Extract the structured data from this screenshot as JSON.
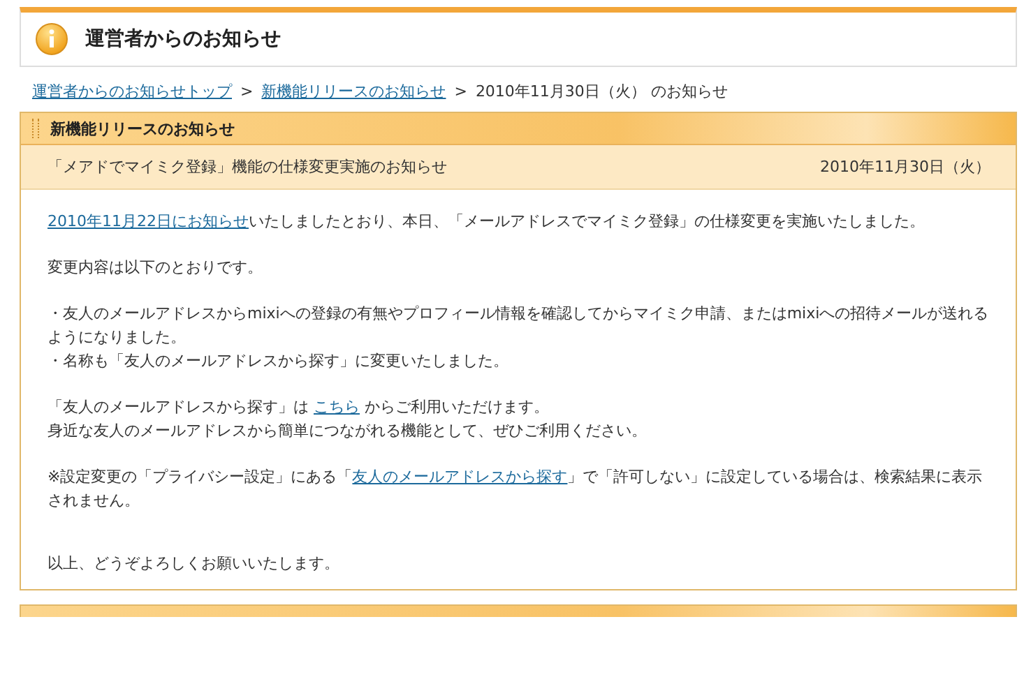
{
  "page_title": "運営者からのお知らせ",
  "breadcrumb": [
    {
      "text": "運営者からのお知らせトップ",
      "kind": "link"
    },
    {
      "text": ">",
      "kind": "separator"
    },
    {
      "text": "新機能リリースのお知らせ",
      "kind": "link"
    },
    {
      "text": ">",
      "kind": "separator"
    },
    {
      "text": "2010年11月30日（火） のお知らせ",
      "kind": "current"
    }
  ],
  "panel": {
    "title": "新機能リリースのお知らせ",
    "subject": "「メアドでマイミク登録」機能の仕様変更実施のお知らせ",
    "date": "2010年11月30日（火）",
    "blocks": [
      {
        "lines": [
          [
            {
              "kind": "link",
              "text": "2010年11月22日にお知らせ"
            },
            {
              "kind": "text",
              "text": "いたしましたとおり、本日、「メールアドレスでマイミク登録」の仕様変更を実施いたしました。"
            }
          ]
        ]
      },
      {
        "lines": [
          [
            {
              "kind": "text",
              "text": "変更内容は以下のとおりです。"
            }
          ]
        ]
      },
      {
        "lines": [
          [
            {
              "kind": "text",
              "text": "・友人のメールアドレスからmixiへの登録の有無やプロフィール情報を確認してからマイミク申請、またはmixiへの招待メールが送れるようになりました。"
            }
          ],
          [
            {
              "kind": "text",
              "text": "・名称も「友人のメールアドレスから探す」に変更いたしました。"
            }
          ]
        ]
      },
      {
        "lines": [
          [
            {
              "kind": "text",
              "text": "「友人のメールアドレスから探す」は "
            },
            {
              "kind": "link",
              "text": "こちら"
            },
            {
              "kind": "text",
              "text": " からご利用いただけます。"
            }
          ],
          [
            {
              "kind": "text",
              "text": "身近な友人のメールアドレスから簡単につながれる機能として、ぜひご利用ください。"
            }
          ]
        ]
      },
      {
        "lines": [
          [
            {
              "kind": "text",
              "text": "※設定変更の「プライバシー設定」にある「"
            },
            {
              "kind": "link",
              "text": "友人のメールアドレスから探す"
            },
            {
              "kind": "text",
              "text": "」で「許可しない」に設定している場合は、検索結果に表示されません。"
            }
          ]
        ]
      },
      {
        "lines": [
          [
            {
              "kind": "text",
              "text": "以上、どうぞよろしくお願いいたします。"
            }
          ]
        ]
      }
    ]
  }
}
